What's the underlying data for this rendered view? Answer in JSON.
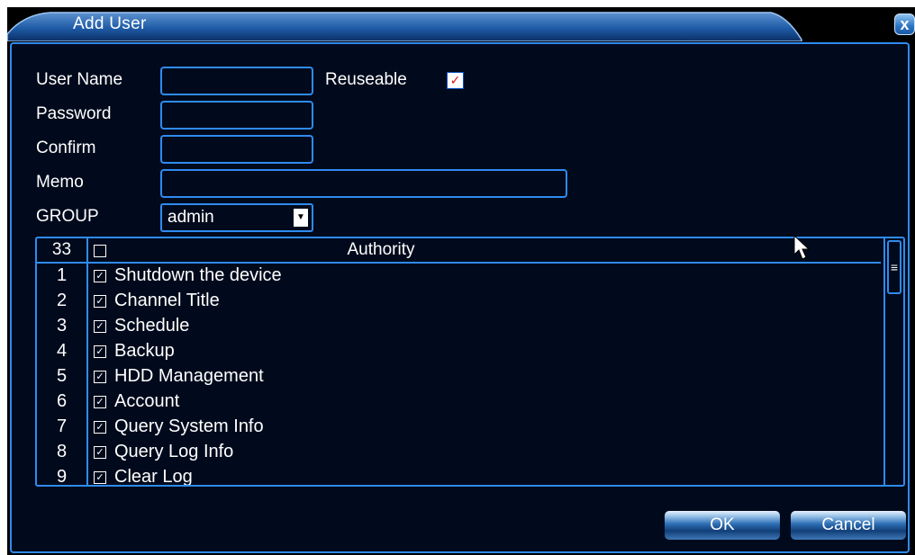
{
  "window": {
    "title": "Add User",
    "close_glyph": "x",
    "colors": {
      "accent": "#2f8bf0",
      "background": "#000a1c",
      "title_bar": "#1f5fa8"
    }
  },
  "form": {
    "user_name_label": "User Name",
    "user_name_value": "",
    "reuseable_label": "Reuseable",
    "reuseable_checked": true,
    "password_label": "Password",
    "password_value": "",
    "confirm_label": "Confirm",
    "confirm_value": "",
    "memo_label": "Memo",
    "memo_value": "",
    "group_label": "GROUP",
    "group_value": "admin"
  },
  "authority": {
    "count": "33",
    "header": "Authority",
    "select_all_checked": false,
    "rows": [
      {
        "num": "1",
        "label": "Shutdown the device",
        "checked": true
      },
      {
        "num": "2",
        "label": "Channel Title",
        "checked": true
      },
      {
        "num": "3",
        "label": "Schedule",
        "checked": true
      },
      {
        "num": "4",
        "label": "Backup",
        "checked": true
      },
      {
        "num": "5",
        "label": "HDD Management",
        "checked": true
      },
      {
        "num": "6",
        "label": "Account",
        "checked": true
      },
      {
        "num": "7",
        "label": "Query System Info",
        "checked": true
      },
      {
        "num": "8",
        "label": "Query Log Info",
        "checked": true
      },
      {
        "num": "9",
        "label": "Clear Log",
        "checked": true
      }
    ]
  },
  "buttons": {
    "ok": "OK",
    "cancel": "Cancel"
  }
}
